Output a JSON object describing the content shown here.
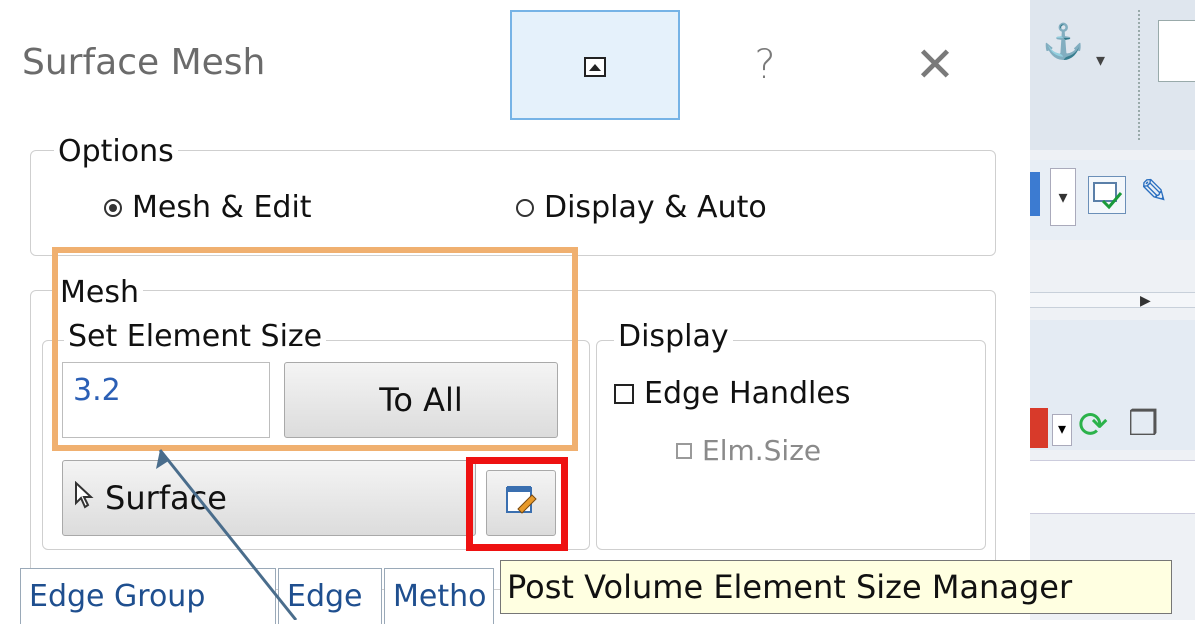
{
  "dialog": {
    "title": "Surface Mesh",
    "title_buttons": {
      "help": "?",
      "close": "✕"
    }
  },
  "options": {
    "label": "Options",
    "radios": [
      {
        "label": "Mesh & Edit",
        "selected": true
      },
      {
        "label": "Display & Auto",
        "selected": false
      }
    ]
  },
  "mesh": {
    "label": "Mesh",
    "set_element_size": {
      "label": "Set Element Size",
      "value": "3.2",
      "to_all_label": "To All"
    },
    "surface_button": "Surface"
  },
  "display": {
    "label": "Display",
    "edge_handles": {
      "label": "Edge Handles",
      "checked": false
    },
    "elm_size": {
      "label": "Elm.Size",
      "checked": false,
      "disabled": true
    }
  },
  "tabs": [
    "Edge Group",
    "Edge",
    "Metho"
  ],
  "tooltip": "Post Volume Element Size Manager",
  "colors": {
    "highlight_orange": "#f0b070",
    "highlight_red": "#ee1111",
    "arrow": "#4a6d8c",
    "accent_blue": "#2b5fb5"
  }
}
